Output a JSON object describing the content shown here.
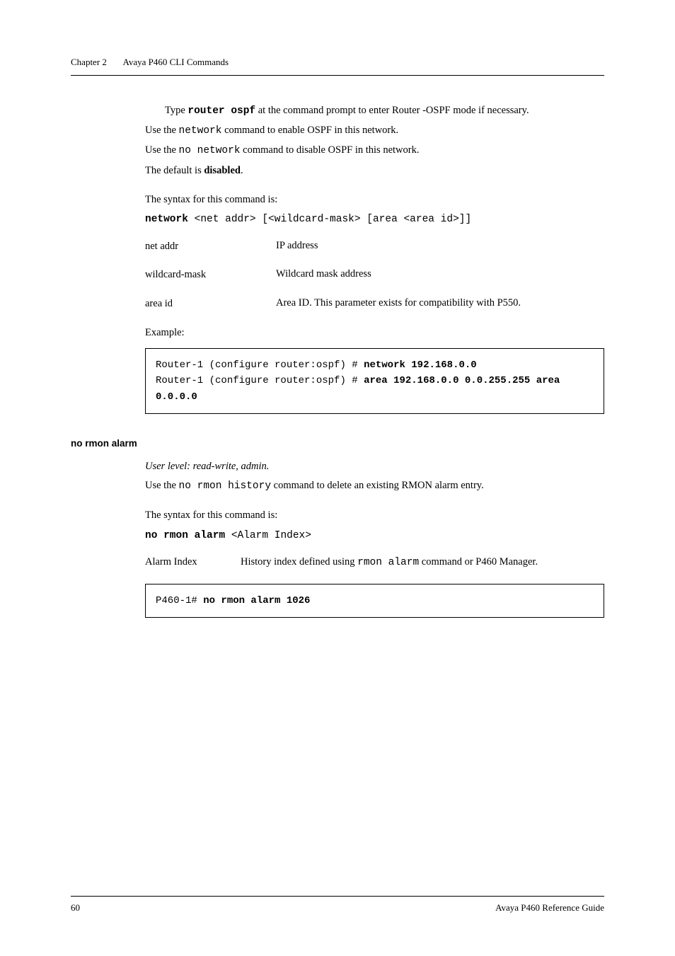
{
  "header": {
    "chapter": "Chapter 2",
    "title": "Avaya P460 CLI Commands"
  },
  "section1": {
    "typeCmd_prefix": "Type ",
    "typeCmd_code": "router ospf",
    "typeCmd_suffix": " at the command prompt to enter Router -OSPF mode if necessary.",
    "useNetwork_pre": "Use the ",
    "useNetwork_code": "network",
    "useNetwork_post": " command to enable OSPF in this network.",
    "useNoNetwork_pre": "Use the ",
    "useNoNetwork_code": " no network",
    "useNoNetwork_post": " command to disable  OSPF in this network.",
    "default_pre": "The default is ",
    "default_bold": "disabled",
    "default_post": ".",
    "syntaxIntro": "The syntax for this command is:",
    "syntaxCmd_bold": "network",
    "syntaxCmd_rest": " <net addr> [<wildcard-mask> [area <area id>]]",
    "params": {
      "row1_name": "net addr",
      "row1_desc": "IP address",
      "row2_name": "wildcard-mask",
      "row2_desc": "Wildcard mask address",
      "row3_name": "area id",
      "row3_desc": "Area ID. This parameter exists for compatibility with P550."
    },
    "exampleLabel": "Example:",
    "code_line1_a": "Router-1 (configure router:ospf) # ",
    "code_line1_b": "network 192.168.0.0",
    "code_line2_a": "Router-1 (configure router:ospf) # ",
    "code_line2_b": "area 192.168.0.0 0.0.255.255 area 0.0.0.0"
  },
  "section2": {
    "heading": "no rmon alarm",
    "userLevel": "User level: read-write, admin.",
    "useCmd_pre": "Use the ",
    "useCmd_code": "no rmon history",
    "useCmd_post": " command to delete an existing RMON alarm entry.",
    "syntaxIntro": "The syntax for this command is:",
    "syntaxCmd_bold": "no rmon alarm",
    "syntaxCmd_rest": " <Alarm Index>",
    "param_name": "Alarm Index",
    "param_desc_pre": "History index defined using ",
    "param_desc_code": "rmon alarm",
    "param_desc_post": " command or P460 Manager.",
    "code_line1_a": "P460-1# ",
    "code_line1_b": "no rmon alarm 1026"
  },
  "footer": {
    "pageNum": "60",
    "docTitle": "Avaya P460 Reference Guide"
  }
}
